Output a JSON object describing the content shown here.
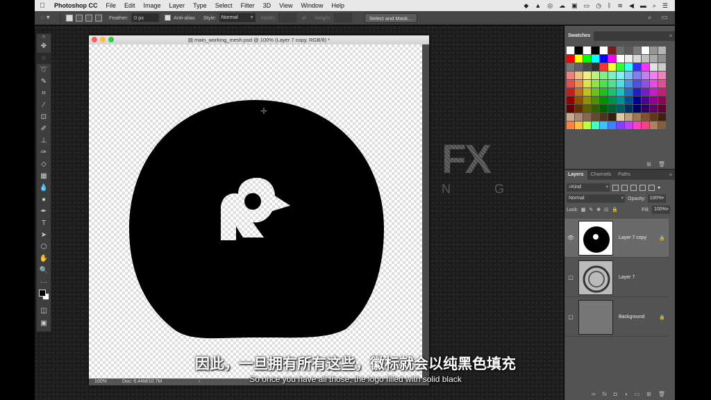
{
  "menubar": {
    "app_name": "Photoshop CC",
    "items": [
      "File",
      "Edit",
      "Image",
      "Layer",
      "Type",
      "Select",
      "Filter",
      "3D",
      "View",
      "Window",
      "Help"
    ]
  },
  "options": {
    "feather_label": "Feather:",
    "feather_value": "0 px",
    "antialias_label": "Anti-alias",
    "style_label": "Style:",
    "style_value": "Normal",
    "width_label": "Width:",
    "height_label": "Height:",
    "select_mask_label": "Select and Mask..."
  },
  "document": {
    "title": "main_working_mesh.psd @ 100% (Layer 7 copy, RGB/8) *",
    "zoom": "100%",
    "doc_size": "Doc: 6.44M/10.7M"
  },
  "watermark": {
    "big": "FX",
    "small": [
      "N",
      "G"
    ]
  },
  "swatches": {
    "tab": "Swatches",
    "colors": [
      [
        "#ffffff",
        "#000000",
        "#ffffff",
        "#000000",
        "#ffffff",
        "#7a1b1b",
        "#6b6b6b",
        "#5a5a5a",
        "#7b7b7b",
        "#ffffff",
        "#959595",
        "#b5b5b5"
      ],
      [
        "#ff0000",
        "#ffff00",
        "#00ff00",
        "#00ffff",
        "#0000ff",
        "#ff00ff",
        "#ffffff",
        "#eeeeee",
        "#d8d8d8",
        "#c0c0c0",
        "#a8a8a8",
        "#909090"
      ],
      [
        "#787878",
        "#606060",
        "#484848",
        "#303030",
        "#ff3333",
        "#ffff33",
        "#33ff33",
        "#33ffff",
        "#3333ff",
        "#ff33ff",
        "#e2e2e2",
        "#cccccc"
      ],
      [
        "#f08080",
        "#f0c080",
        "#f0f080",
        "#c0f080",
        "#80f080",
        "#80f0c0",
        "#80f0f0",
        "#80c0f0",
        "#8080f0",
        "#c080f0",
        "#f080f0",
        "#f080c0"
      ],
      [
        "#e05050",
        "#e09050",
        "#e0e050",
        "#90e050",
        "#50e050",
        "#50e090",
        "#50e0e0",
        "#5090e0",
        "#5050e0",
        "#9050e0",
        "#e050e0",
        "#e05090"
      ],
      [
        "#c02020",
        "#c07020",
        "#c0c020",
        "#70c020",
        "#20c020",
        "#20c070",
        "#20c0c0",
        "#2070c0",
        "#2020c0",
        "#7020c0",
        "#c020c0",
        "#c02070"
      ],
      [
        "#900000",
        "#905000",
        "#909000",
        "#509000",
        "#009000",
        "#009050",
        "#009090",
        "#005090",
        "#000090",
        "#500090",
        "#900090",
        "#900050"
      ],
      [
        "#600000",
        "#603000",
        "#606000",
        "#306000",
        "#006000",
        "#006030",
        "#006060",
        "#003060",
        "#000060",
        "#300060",
        "#600060",
        "#600030"
      ],
      [
        "#c8a890",
        "#a88870",
        "#886850",
        "#684830",
        "#4c3420",
        "#302010",
        "#e0c8a8",
        "#c0a080",
        "#a07850",
        "#805030",
        "#603818",
        "#402010"
      ],
      [
        "#ff8040",
        "#ffc040",
        "#c0ff40",
        "#40ffc0",
        "#40c0ff",
        "#4080ff",
        "#8040ff",
        "#c040ff",
        "#ff40c0",
        "#ff4080",
        "#b08060",
        "#806040"
      ]
    ]
  },
  "layers": {
    "tabs": [
      "Layers",
      "Channels",
      "Paths"
    ],
    "kind_label": "Kind",
    "blend_mode": "Normal",
    "opacity_label": "Opacity:",
    "opacity_value": "100%",
    "lock_label": "Lock:",
    "fill_label": "Fill:",
    "fill_value": "100%",
    "items": [
      {
        "name": "Layer 7 copy",
        "selected": true
      },
      {
        "name": "Layer 7",
        "selected": false
      },
      {
        "name": "Background",
        "selected": false
      }
    ]
  },
  "subtitles": {
    "chinese": "因此，一旦拥有所有这些，徽标就会以纯黑色填充",
    "english": "So once you have all those, the logo filled with solid black"
  }
}
